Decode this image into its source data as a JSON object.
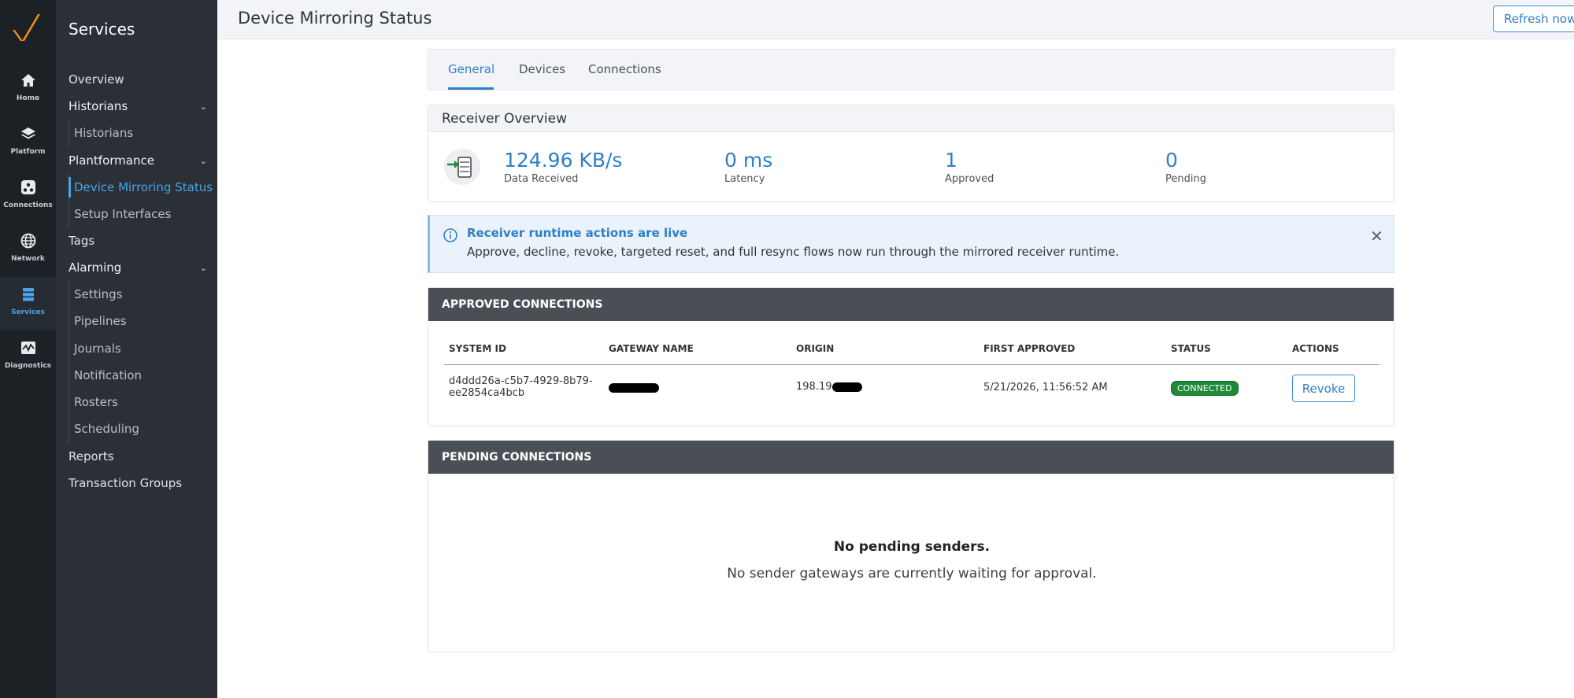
{
  "rail": {
    "items": [
      {
        "label": "Home",
        "icon": "home-icon"
      },
      {
        "label": "Platform",
        "icon": "layers-icon"
      },
      {
        "label": "Connections",
        "icon": "connections-icon"
      },
      {
        "label": "Network",
        "icon": "globe-icon"
      },
      {
        "label": "Services",
        "icon": "services-icon",
        "active": true
      },
      {
        "label": "Diagnostics",
        "icon": "diagnostics-icon"
      }
    ]
  },
  "nav": {
    "title": "Services",
    "overview": "Overview",
    "historians_group": "Historians",
    "historians_item": "Historians",
    "plantformance_group": "Plantformance",
    "device_mirroring_status": "Device Mirroring Status",
    "setup_interfaces": "Setup Interfaces",
    "tags": "Tags",
    "alarming_group": "Alarming",
    "alarming_items": [
      "Settings",
      "Pipelines",
      "Journals",
      "Notification",
      "Rosters",
      "Scheduling"
    ],
    "reports": "Reports",
    "transaction_groups": "Transaction Groups"
  },
  "header": {
    "title": "Device Mirroring Status",
    "refresh_label": "Refresh now"
  },
  "tabs": [
    "General",
    "Devices",
    "Connections"
  ],
  "receiver_overview": {
    "title": "Receiver Overview",
    "stats": [
      {
        "value": "124.96 KB/s",
        "label": "Data Received"
      },
      {
        "value": "0 ms",
        "label": "Latency"
      },
      {
        "value": "1",
        "label": "Approved"
      },
      {
        "value": "0",
        "label": "Pending"
      }
    ]
  },
  "alert": {
    "title": "Receiver runtime actions are live",
    "text": "Approve, decline, revoke, targeted reset, and full resync flows now run through the mirrored receiver runtime.",
    "close": "✕"
  },
  "approved": {
    "title": "APPROVED CONNECTIONS",
    "columns": [
      "SYSTEM ID",
      "GATEWAY NAME",
      "ORIGIN",
      "FIRST APPROVED",
      "STATUS",
      "ACTIONS"
    ],
    "row": {
      "system_id_line1": "d4ddd26a-c5b7-4929-8b79-",
      "system_id_line2": "ee2854ca4bcb",
      "origin_prefix": "198.19",
      "first_approved": "5/21/2026, 11:56:52 AM",
      "status": "CONNECTED",
      "action": "Revoke"
    }
  },
  "pending": {
    "title": "PENDING CONNECTIONS",
    "empty_title": "No pending senders.",
    "empty_text": "No sender gateways are currently waiting for approval."
  },
  "colors": {
    "accent": "#2f7fc8",
    "rail_bg": "#1c2126",
    "nav_bg": "#2b3036",
    "connected_green": "#1d8a3a",
    "dark_header": "#4a4f55"
  }
}
